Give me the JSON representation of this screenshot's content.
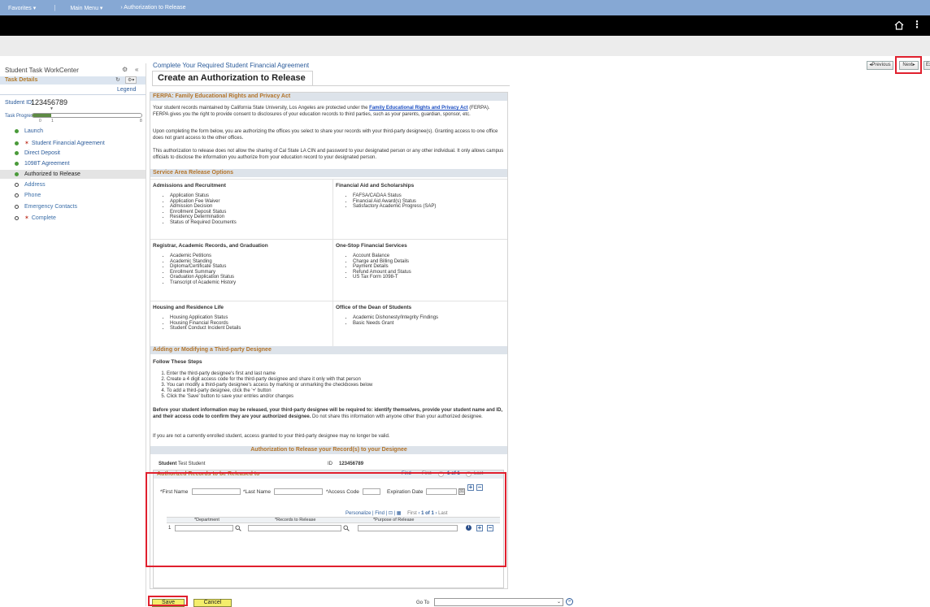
{
  "topnav": {
    "favorites": "Favorites ▾",
    "main_menu": "Main Menu ▾",
    "breadcrumb": "›  Authorization to Release"
  },
  "header": {
    "home_icon": "home-icon",
    "more_icon": "more-vertical-icon"
  },
  "left_panel": {
    "title": "Student Task WorkCenter",
    "task_details": "Task Details",
    "legend": "Legend",
    "student_id_label": "Student ID:",
    "student_id_value": "123456789",
    "task_progress_label": "Task Progress",
    "progress_fraction": 0.17,
    "progress_start": "0",
    "progress_mark": "1",
    "progress_end": "8",
    "steps": [
      {
        "label": "Launch",
        "status": "done",
        "required": false
      },
      {
        "label": "Student Financial Agreement",
        "status": "done",
        "required": true
      },
      {
        "label": "Direct Deposit",
        "status": "done",
        "required": false
      },
      {
        "label": "1098T Agreement",
        "status": "done",
        "required": false
      },
      {
        "label": "Authorized to Release",
        "status": "current",
        "required": false
      },
      {
        "label": "Address",
        "status": "todo",
        "required": false
      },
      {
        "label": "Phone",
        "status": "todo",
        "required": false
      },
      {
        "label": "Emergency Contacts",
        "status": "todo",
        "required": false
      },
      {
        "label": "Complete",
        "status": "todo",
        "required": true
      }
    ],
    "required_mark": "✶"
  },
  "main": {
    "agreement_link": "Complete Your Required Student Financial Agreement",
    "page_title": "Create an Authorization to Release",
    "prev_label": "◂Previous",
    "next_label": "Next▸",
    "exit_label": "Exit"
  },
  "ferpa": {
    "heading": "FERPA: Family Educational Rights and Privacy Act",
    "p1_a": "Your student records maintained by California State University, Los Angeles are protected under the ",
    "p1_link": "Family Educational Rights and Privacy Act",
    "p1_b": " (FERPA). FERPA gives you the right to provide consent to disclosures of your education records to third parties, such as your parents, guardian, sponsor, etc.",
    "p2": "Upon completing the form below, you are authorizing the offices you select to share your records with your third-party designee(s). Granting access to one office does not grant access to the other offices.",
    "p3": "This authorization to release does not allow the sharing of Cal State LA CIN and password to your designated person or any other individual. It only allows campus officials to disclose the information you authorize from your education record to your designated person."
  },
  "service": {
    "heading": "Service Area Release Options",
    "areas": [
      {
        "title": "Admissions and Recruitment",
        "items": [
          "Application Status",
          "Application Fee Waiver",
          "Admission Decision",
          "Enrollment Deposit Status",
          "Residency Determination",
          "Status of Required Documents"
        ]
      },
      {
        "title": "Financial Aid and Scholarships",
        "items": [
          "FAFSA/CADAA Status",
          "Financial Aid Award(s) Status",
          "Satisfactory Academic Progress (SAP)"
        ]
      },
      {
        "title": "Registrar, Academic Records, and Graduation",
        "items": [
          "Academic Petitions",
          "Academic Standing",
          "Diploma/Certificate Status",
          "Enrollment Summary",
          "Graduation Application Status",
          "Transcript of Academic History"
        ]
      },
      {
        "title": "One-Stop Financial Services",
        "items": [
          "Account Balance",
          "Charge and Billing Details",
          "Payment Details",
          "Refund Amount and Status",
          "US Tax Form 1098-T"
        ]
      },
      {
        "title": "Housing and Residence Life",
        "items": [
          "Housing Application Status",
          "Housing Financial Records",
          "Student Conduct Incident Details"
        ]
      },
      {
        "title": "Office of the Dean of Students",
        "items": [
          "Academic Dishonesty/Integrity Findings",
          "Basic Needs Grant"
        ]
      }
    ]
  },
  "designee": {
    "heading": "Adding or Modifying a Third-party Designee",
    "follow_title": "Follow These Steps",
    "steps": [
      "Enter the third-party designee's first and last name",
      "Create a 4 digit access code for the third-party designee and share it only with that person",
      "You can modify a third-party designee's access by marking or unmarking the checkboxes below",
      "To add a third-party designee, click the '+' button",
      "Click the 'Save' button to save your entries and/or changes"
    ],
    "warning_bold": "Before your student information may be released, your third-party designee will be required to: identify themselves, provide your student name and ID, and their access code to confirm they are your authorized designee.",
    "warning_rest": " Do not share this information with anyone other than your authorized designee.",
    "not_enrolled": "If you are not a currently enrolled student, access granted to your third-party designee may no longer be valid."
  },
  "authorization": {
    "heading": "Authorization to Release your Record(s) to your Designee",
    "student_label": "Student",
    "student_value": "Test Student",
    "id_label": "ID",
    "id_value": "123456789",
    "records_title": "Authorized Records to be Released to",
    "find": "Find",
    "first": "First",
    "count": "1 of 1",
    "last": "Last",
    "first_name_label": "*First Name",
    "last_name_label": "*Last Name",
    "access_code_label": "*Access Code",
    "expiration_label": "Expiration Date",
    "grid_tools": {
      "personalize": "Personalize",
      "find": "Find",
      "first": "First",
      "count": "1 of 1",
      "last": "Last"
    },
    "columns": [
      "*Department",
      "*Records to Release",
      "*Purpose of Release"
    ],
    "row_number": "1"
  },
  "footer": {
    "save_label": "Save",
    "cancel_label": "Cancel",
    "goto_label": "Go To"
  }
}
